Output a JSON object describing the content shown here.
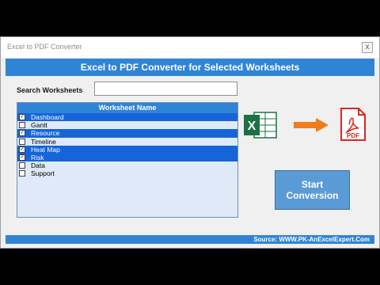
{
  "window": {
    "title": "Excel to PDF Converter",
    "close_glyph": "x"
  },
  "header": {
    "title": "Excel to PDF Converter for Selected Worksheets"
  },
  "search": {
    "label": "Search Worksheets",
    "value": ""
  },
  "list": {
    "header": "Worksheet Name",
    "items": [
      {
        "label": "Dashboard",
        "checked": true,
        "selected": true
      },
      {
        "label": "Gantt",
        "checked": false,
        "selected": false
      },
      {
        "label": "Resource",
        "checked": true,
        "selected": true
      },
      {
        "label": "Timeline",
        "checked": false,
        "selected": false
      },
      {
        "label": "Heat Map",
        "checked": true,
        "selected": true
      },
      {
        "label": "Risk",
        "checked": true,
        "selected": true
      },
      {
        "label": "Data",
        "checked": false,
        "selected": false
      },
      {
        "label": "Support",
        "checked": false,
        "selected": false
      }
    ]
  },
  "icons": {
    "excel": "excel-icon",
    "arrow": "arrow-right-icon",
    "pdf": "pdf-icon",
    "excel_letter": "X",
    "pdf_text": "PDF"
  },
  "button": {
    "line1": "Start",
    "line2": "Conversion"
  },
  "footer": {
    "text": "Source: WWW.PK-AnExcelExpert.Com"
  },
  "colors": {
    "accent_blue": "#2f84d6",
    "selected_blue": "#1565d8",
    "button_blue": "#5b9bd5",
    "excel_green": "#1d7044",
    "arrow_orange": "#f07c1c",
    "pdf_red": "#d9261c"
  }
}
